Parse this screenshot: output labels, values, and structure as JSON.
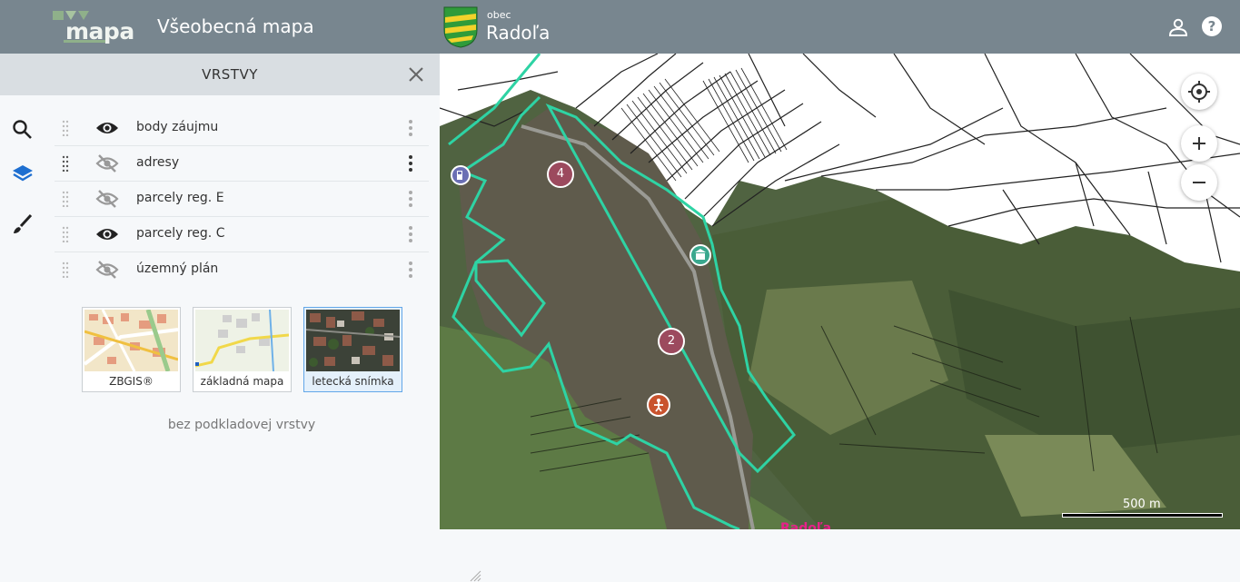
{
  "header": {
    "logo_text": "mapa",
    "app_title": "Všeobecná mapa",
    "municipality_type": "obec",
    "municipality_name": "Radoľa",
    "colors": {
      "bar": "#78868f",
      "coat_green": "#2f9b3a",
      "coat_yellow": "#f2d22b"
    }
  },
  "sidebar": {
    "items": [
      {
        "name": "search",
        "icon": "search-icon"
      },
      {
        "name": "layers",
        "icon": "layers-icon",
        "active": true
      },
      {
        "name": "draw",
        "icon": "brush-icon"
      }
    ]
  },
  "panel": {
    "title": "VRSTVY",
    "layers": [
      {
        "label": "body záujmu",
        "visible": true
      },
      {
        "label": "adresy",
        "visible": false
      },
      {
        "label": "parcely reg. E",
        "visible": false
      },
      {
        "label": "parcely reg. C",
        "visible": true
      },
      {
        "label": "územný plán",
        "visible": false
      }
    ],
    "basemaps": [
      {
        "label": "ZBGIS®",
        "active": false
      },
      {
        "label": "základná mapa",
        "active": false
      },
      {
        "label": "letecká snímka",
        "active": true
      }
    ],
    "no_base_label": "bez podkladovej vrstvy"
  },
  "map": {
    "scale_label": "500 m",
    "place_label": "Radoľa",
    "markers": [
      {
        "label": "4",
        "kind": "cluster"
      },
      {
        "label": "2",
        "kind": "cluster"
      },
      {
        "label": "",
        "kind": "fuel-icon"
      },
      {
        "label": "",
        "kind": "building-icon"
      },
      {
        "label": "",
        "kind": "playground-icon"
      }
    ],
    "controls": [
      "locate-icon",
      "zoom-in-icon",
      "zoom-out-icon"
    ],
    "colors": {
      "boundary": "#2ed3a4",
      "cluster": "#9c4a5e"
    }
  }
}
